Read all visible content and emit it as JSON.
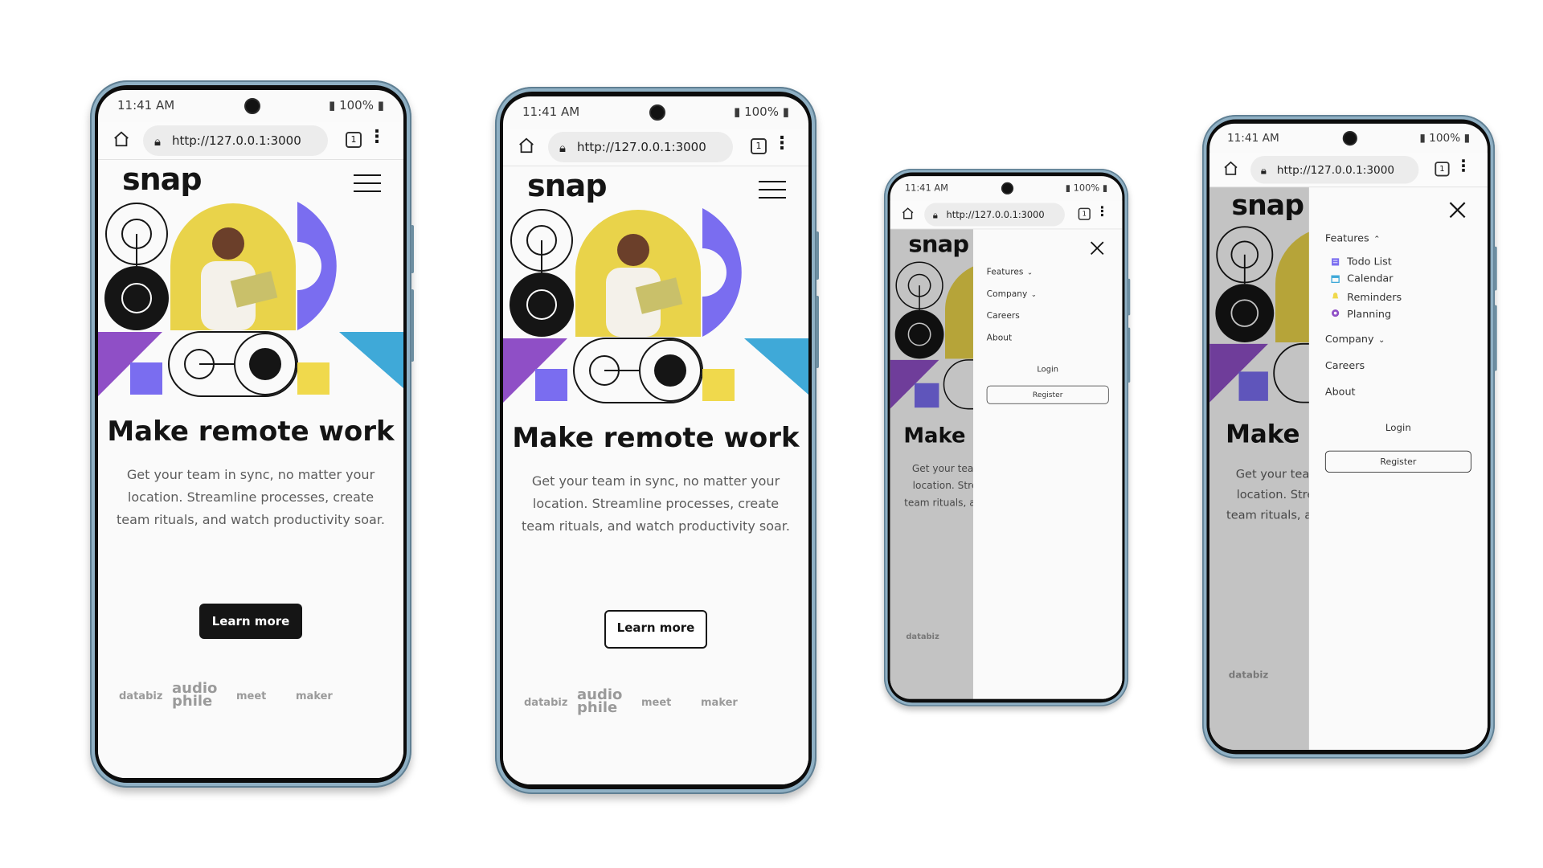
{
  "status": {
    "time": "11:41 AM",
    "battery": "100%"
  },
  "browser": {
    "url": "http://127.0.0.1:3000",
    "tab_count": "1"
  },
  "site": {
    "logo": "snap",
    "headline": "Make remote work",
    "subtext": "Get your team in sync, no matter your location. Streamline processes, create team rituals, and watch productivity soar.",
    "cta_label": "Learn more",
    "partners": [
      "databiz",
      "audio phile",
      "meet",
      "maker"
    ]
  },
  "menu": {
    "items": [
      {
        "label": "Features"
      },
      {
        "label": "Company"
      },
      {
        "label": "Careers"
      },
      {
        "label": "About"
      }
    ],
    "features_sub": [
      {
        "label": "Todo List",
        "icon": "todo-icon"
      },
      {
        "label": "Calendar",
        "icon": "calendar-icon"
      },
      {
        "label": "Reminders",
        "icon": "reminders-icon"
      },
      {
        "label": "Planning",
        "icon": "planning-icon"
      }
    ],
    "login": "Login",
    "register": "Register"
  },
  "colors": {
    "accent_purple": "#7a6df0",
    "accent_violet": "#8f4fc6",
    "accent_blue": "#3fa9d8",
    "accent_yellow": "#f0d94c",
    "dark": "#151515"
  }
}
